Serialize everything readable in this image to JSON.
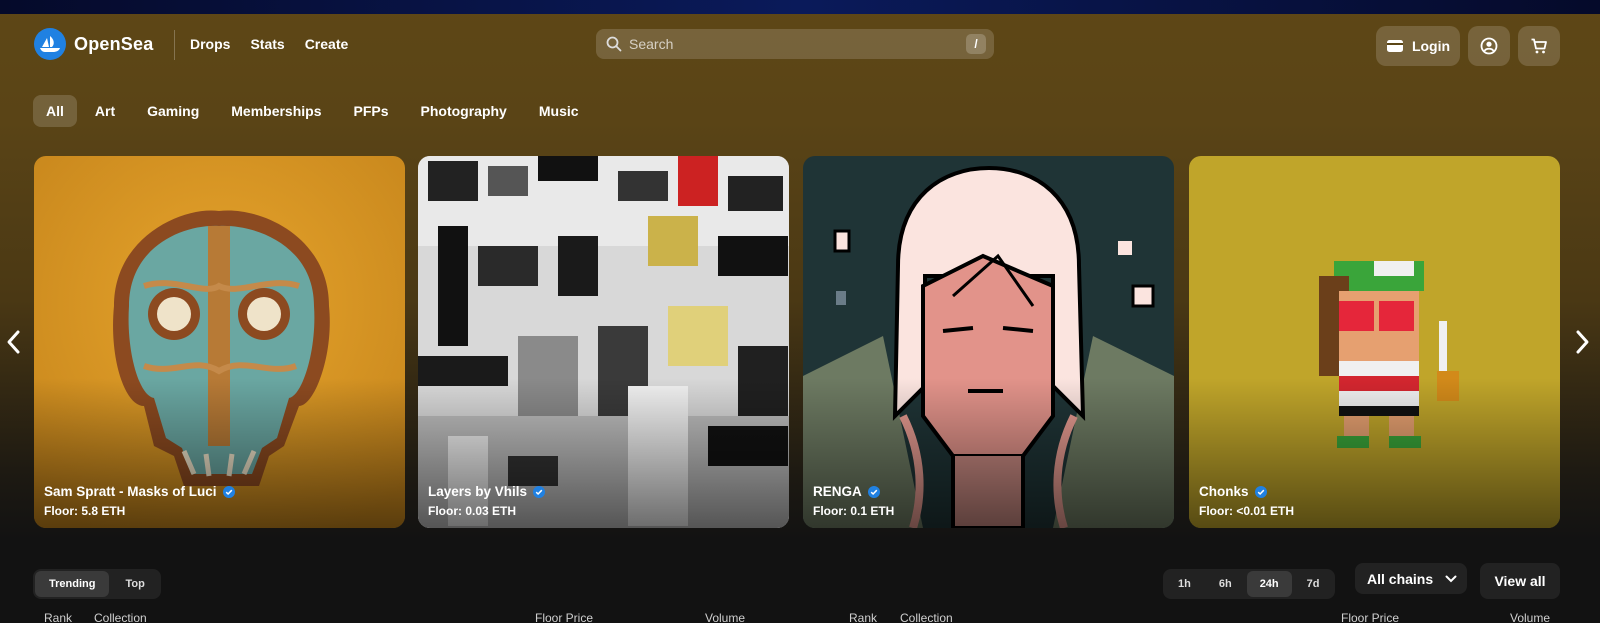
{
  "brand": {
    "name": "OpenSea"
  },
  "nav": [
    "Drops",
    "Stats",
    "Create"
  ],
  "search": {
    "placeholder": "Search",
    "shortcut": "/"
  },
  "header_actions": {
    "login_label": "Login"
  },
  "categories": [
    "All",
    "Art",
    "Gaming",
    "Memberships",
    "PFPs",
    "Photography",
    "Music"
  ],
  "active_category": "All",
  "featured": [
    {
      "name": "Sam Spratt - Masks of Luci",
      "floor": "Floor: 5.8 ETH",
      "verified": true
    },
    {
      "name": "Layers by Vhils",
      "floor": "Floor: 0.03 ETH",
      "verified": true
    },
    {
      "name": "RENGA",
      "floor": "Floor: 0.1 ETH",
      "verified": true
    },
    {
      "name": "Chonks",
      "floor": "Floor: <0.01 ETH",
      "verified": true
    }
  ],
  "ranking_tabs": [
    "Trending",
    "Top"
  ],
  "active_ranking_tab": "Trending",
  "time_ranges": [
    "1h",
    "6h",
    "24h",
    "7d"
  ],
  "active_time_range": "24h",
  "chain_filter": "All chains",
  "view_all_label": "View all",
  "columns": [
    "Rank",
    "Collection",
    "Floor Price",
    "Volume"
  ],
  "colors": {
    "accent": "#2081e2",
    "verified": "#2081e2"
  }
}
